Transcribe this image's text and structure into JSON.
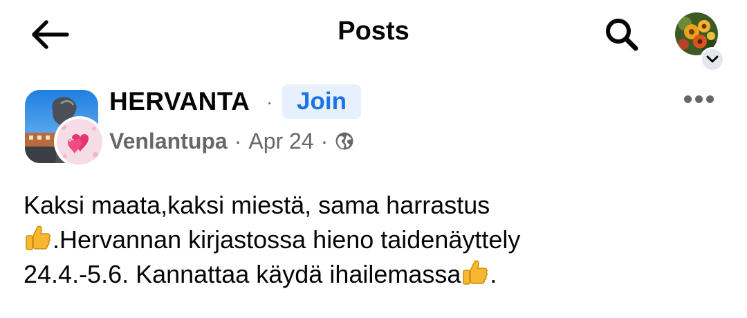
{
  "topbar": {
    "title": "Posts",
    "back_icon": "arrow-left-icon",
    "search_icon": "search-icon",
    "profile_icon": "avatar",
    "chevron_icon": "chevron-down-icon"
  },
  "post": {
    "group_name": "HERVANTA",
    "separator": "·",
    "join_label": "Join",
    "author": "Venlantupa",
    "date": "Apr 24",
    "audience_icon": "globe-icon",
    "more_icon": "more-horizontal-icon",
    "text_lines": [
      "Kaksi maata,kaksi miestä, sama harrastus",
      ".Hervannan kirjastossa hieno taidenäyttely",
      "24.4.-5.6. Kannattaa käydä ihailemassa",
      "."
    ],
    "emoji": "thumbs-up-emoji"
  },
  "colors": {
    "accent": "#1b74e4",
    "join_bg": "#e7f0fd",
    "secondary_text": "#65676b",
    "primary_text": "#050505"
  }
}
